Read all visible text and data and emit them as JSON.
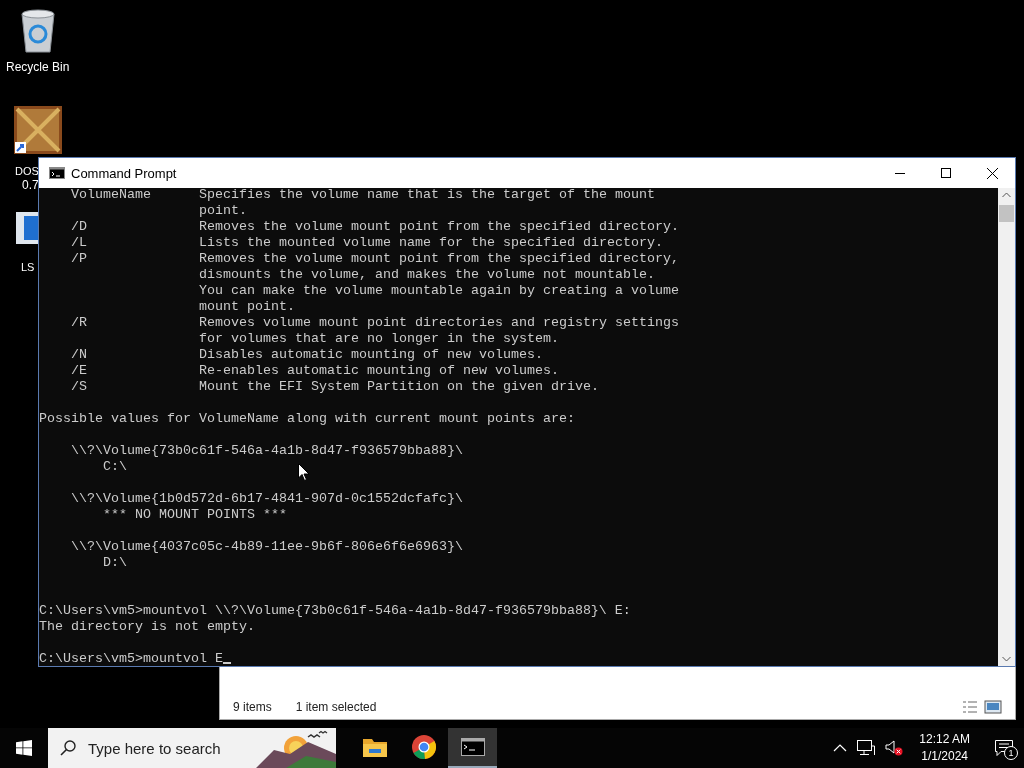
{
  "desktop_icons": [
    {
      "label": "Recycle Bin",
      "kind": "bin"
    },
    {
      "label": "DOS",
      "label_2": "0.7",
      "kind": "box"
    },
    {
      "label": "LS",
      "kind": "app"
    }
  ],
  "explorer": {
    "status": [
      "9 items",
      "1 item selected"
    ]
  },
  "console_window": {
    "title": "Command Prompt",
    "lines": [
      {
        "kind": "option",
        "switch": "VolumeName",
        "text": "Specifies the volume name that is the target of the mount"
      },
      {
        "kind": "cont",
        "text": "point."
      },
      {
        "kind": "option",
        "switch": "/D",
        "text": "Removes the volume mount point from the specified directory."
      },
      {
        "kind": "option",
        "switch": "/L",
        "text": "Lists the mounted volume name for the specified directory."
      },
      {
        "kind": "option",
        "switch": "/P",
        "text": "Removes the volume mount point from the specified directory,"
      },
      {
        "kind": "cont",
        "text": "dismounts the volume, and makes the volume not mountable."
      },
      {
        "kind": "cont",
        "text": "You can make the volume mountable again by creating a volume"
      },
      {
        "kind": "cont",
        "text": "mount point."
      },
      {
        "kind": "option",
        "switch": "/R",
        "text": "Removes volume mount point directories and registry settings"
      },
      {
        "kind": "cont",
        "text": "for volumes that are no longer in the system."
      },
      {
        "kind": "option",
        "switch": "/N",
        "text": "Disables automatic mounting of new volumes."
      },
      {
        "kind": "option",
        "switch": "/E",
        "text": "Re-enables automatic mounting of new volumes."
      },
      {
        "kind": "option",
        "switch": "/S",
        "text": "Mount the EFI System Partition on the given drive."
      },
      {
        "kind": "blank"
      },
      {
        "kind": "plain",
        "text": "Possible values for VolumeName along with current mount points are:"
      },
      {
        "kind": "blank"
      },
      {
        "kind": "volume",
        "text": "\\\\?\\Volume{73b0c61f-546a-4a1b-8d47-f936579bba88}\\"
      },
      {
        "kind": "mount",
        "text": "C:\\"
      },
      {
        "kind": "blank"
      },
      {
        "kind": "volume",
        "text": "\\\\?\\Volume{1b0d572d-6b17-4841-907d-0c1552dcfafc}\\"
      },
      {
        "kind": "mount",
        "text": "*** NO MOUNT POINTS ***"
      },
      {
        "kind": "blank"
      },
      {
        "kind": "volume",
        "text": "\\\\?\\Volume{4037c05c-4b89-11ee-9b6f-806e6f6e6963}\\"
      },
      {
        "kind": "mount",
        "text": "D:\\"
      },
      {
        "kind": "blank"
      },
      {
        "kind": "blank"
      },
      {
        "kind": "plain",
        "text": "C:\\Users\\vm5>mountvol \\\\?\\Volume{73b0c61f-546a-4a1b-8d47-f936579bba88}\\ E:"
      },
      {
        "kind": "plain",
        "text": "The directory is not empty."
      },
      {
        "kind": "blank"
      },
      {
        "kind": "plain",
        "text": "C:\\Users\\vm5>mountvol E",
        "cursor": true
      }
    ]
  },
  "taskbar": {
    "search": {
      "placeholder": "Type here to search"
    },
    "apps": [
      {
        "kind": "folder",
        "selected": false
      },
      {
        "kind": "browser",
        "selected": false
      },
      {
        "kind": "terminal",
        "selected": true
      }
    ],
    "clock": {
      "time": "12:12 AM",
      "date": "1/1/2024"
    },
    "notifications": {
      "count": "1"
    }
  }
}
